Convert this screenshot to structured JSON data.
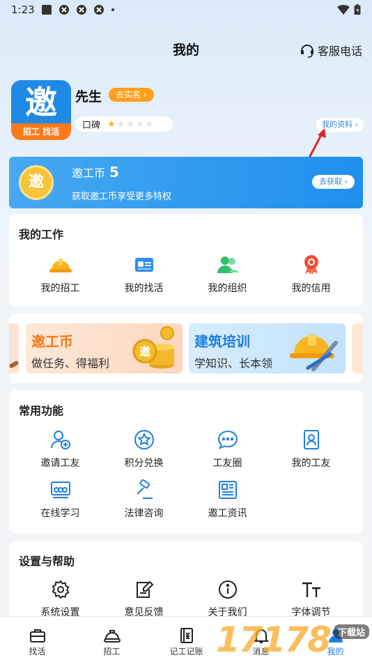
{
  "status_bar": {
    "time": "1:23"
  },
  "header": {
    "title": "我的",
    "service_label": "客服电话"
  },
  "profile": {
    "logo_main": "邀",
    "logo_band": "招工 找活",
    "name": "先生",
    "verify_label": "去实名",
    "reputation_label": "口碑",
    "reputation_rating": 1,
    "reputation_max": 5,
    "my_profile_label": "我的资料"
  },
  "coins": {
    "logo_char": "邀",
    "title": "邀工币",
    "count": "5",
    "description": "获取邀工币享受更多特权",
    "action_label": "去获取"
  },
  "my_work": {
    "title": "我的工作",
    "items": [
      {
        "label": "我的招工",
        "icon": "hardhat-icon"
      },
      {
        "label": "我的找活",
        "icon": "id-card-icon"
      },
      {
        "label": "我的组织",
        "icon": "group-icon"
      },
      {
        "label": "我的信用",
        "icon": "medal-icon"
      }
    ]
  },
  "promos": [
    {
      "title": "邀工币",
      "subtitle": "做任务、得福利"
    },
    {
      "title": "建筑培训",
      "subtitle": "学知识、长本领"
    }
  ],
  "common": {
    "title": "常用功能",
    "items": [
      {
        "label": "邀请工友",
        "icon": "invite-user-icon"
      },
      {
        "label": "积分兑换",
        "icon": "star-badge-icon"
      },
      {
        "label": "工友圈",
        "icon": "chat-bubble-icon"
      },
      {
        "label": "我的工友",
        "icon": "contact-book-icon"
      },
      {
        "label": "在线学习",
        "icon": "video-lesson-icon"
      },
      {
        "label": "法律咨询",
        "icon": "gavel-icon"
      },
      {
        "label": "邀工资讯",
        "icon": "news-icon"
      }
    ]
  },
  "settings": {
    "title": "设置与帮助",
    "items": [
      {
        "label": "系统设置",
        "icon": "gear-icon"
      },
      {
        "label": "意见反馈",
        "icon": "feedback-icon"
      },
      {
        "label": "关于我们",
        "icon": "info-icon"
      },
      {
        "label": "字体调节",
        "icon": "font-size-icon"
      }
    ]
  },
  "bottom_nav": {
    "items": [
      {
        "label": "找活",
        "icon": "briefcase-icon"
      },
      {
        "label": "招工",
        "icon": "hardhat-icon"
      },
      {
        "label": "记工记账",
        "icon": "ledger-icon"
      },
      {
        "label": "消息",
        "icon": "bell-icon"
      },
      {
        "label": "我的",
        "icon": "person-icon"
      }
    ],
    "active_index": 4
  },
  "watermark": {
    "main": "17178",
    "sub": "下载站"
  },
  "colors": {
    "accent": "#1f8ae6",
    "orange": "#ff9f1c",
    "star": "#f5b41a"
  }
}
